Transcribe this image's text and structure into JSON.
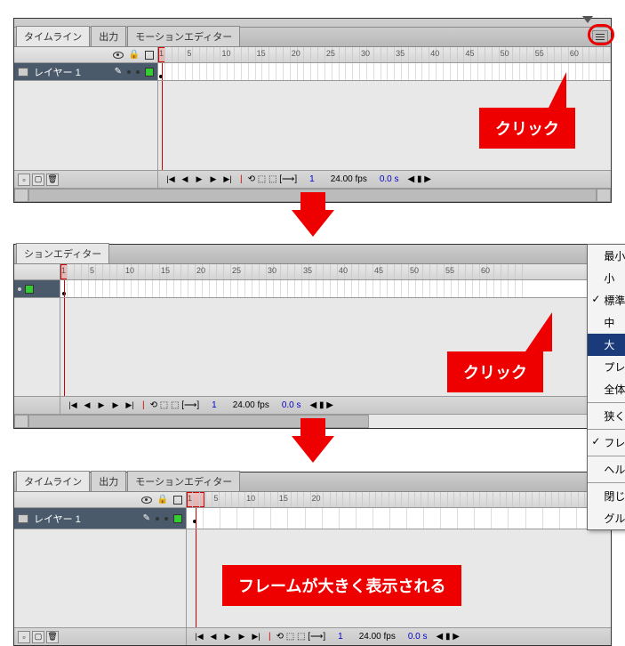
{
  "panel1": {
    "tabs": [
      "タイムライン",
      "出力",
      "モーションエディター"
    ],
    "activeTab": 0,
    "layerName": "レイヤー 1",
    "rulerNums": [
      1,
      5,
      10,
      15,
      20,
      25,
      30,
      35,
      40,
      45,
      50,
      55,
      60
    ],
    "frameNum": "1",
    "fps": "24.00 fps",
    "time": "0.0 s",
    "callout": "クリック"
  },
  "panel2": {
    "tab": "ションエディター",
    "rulerNums": [
      1,
      5,
      10,
      15,
      20,
      25,
      30,
      35,
      40,
      45,
      50,
      55,
      60
    ],
    "frameNum": "1",
    "fps": "24.00 fps",
    "time": "0.0 s",
    "callout": "クリック",
    "menu": {
      "items": [
        {
          "label": "最小",
          "checked": false
        },
        {
          "label": "小",
          "checked": false
        },
        {
          "label": "標準",
          "checked": true
        },
        {
          "label": "中",
          "checked": false
        },
        {
          "label": "大",
          "checked": false,
          "highlight": true
        },
        {
          "label": "プレビュー",
          "checked": false
        },
        {
          "label": "全体のプレビュー",
          "checked": false
        }
      ],
      "items2": [
        {
          "label": "狭く",
          "checked": false
        }
      ],
      "items3": [
        {
          "label": "フレームの淡色表示",
          "checked": true
        }
      ],
      "items4": [
        {
          "label": "ヘルプ",
          "checked": false
        }
      ],
      "items5": [
        {
          "label": "閉じる",
          "checked": false
        },
        {
          "label": "グループを閉じる",
          "checked": false
        }
      ]
    }
  },
  "panel3": {
    "tabs": [
      "タイムライン",
      "出力",
      "モーションエディター"
    ],
    "activeTab": 0,
    "layerName": "レイヤー 1",
    "rulerNums": [
      1,
      5,
      10,
      15,
      20
    ],
    "frameNum": "1",
    "fps": "24.00 fps",
    "time": "0.0 s",
    "callout": "フレームが大きく表示される"
  }
}
